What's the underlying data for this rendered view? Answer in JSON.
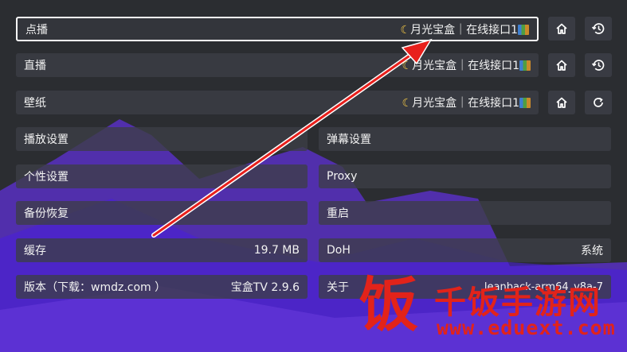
{
  "settings": {
    "vod": {
      "label": "点播",
      "value": "月光宝盒｜在线接口1"
    },
    "live": {
      "label": "直播",
      "value": "月光宝盒｜在线接口1"
    },
    "wallpaper": {
      "label": "壁纸",
      "value": "月光宝盒｜在线接口1"
    },
    "playback_settings": {
      "label": "播放设置"
    },
    "danmaku_settings": {
      "label": "弹幕设置"
    },
    "personal_settings": {
      "label": "个性设置"
    },
    "proxy": {
      "label": "Proxy"
    },
    "backup_restore": {
      "label": "备份恢复"
    },
    "restart": {
      "label": "重启"
    },
    "cache": {
      "label": "缓存",
      "value": "19.7 MB"
    },
    "doh": {
      "label": "DoH",
      "value": "系统"
    },
    "version": {
      "label": "版本（下载：wmdz.com ）",
      "value": "宝盒TV 2.9.6"
    },
    "about": {
      "label": "关于",
      "value": "leanback-arm64_v8a-7"
    }
  },
  "icons": {
    "home": "home-icon",
    "history": "history-icon",
    "refresh": "refresh-icon",
    "moon": "moon-icon",
    "books": "books-icon"
  },
  "watermark": {
    "logo_char": "饭",
    "title": "千饭手游网",
    "url": "www.eduext.com"
  },
  "colors": {
    "background": "#2b2d31",
    "focus_border": "#ffffff",
    "annotation_arrow": "#e8201c",
    "watermark": "#e2231a"
  }
}
